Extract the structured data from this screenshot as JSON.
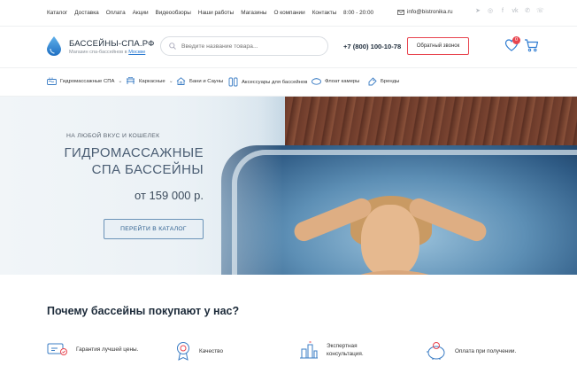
{
  "topbar": {
    "nav": [
      "Каталог",
      "Доставка",
      "Оплата",
      "Акции",
      "Видеообзоры",
      "Наши работы",
      "Магазины",
      "О компании",
      "Контакты"
    ],
    "hours": "8:00 - 20:00",
    "email": "info@bistronika.ru",
    "socials": [
      "telegram-icon",
      "instagram-icon",
      "facebook-icon",
      "vk-icon",
      "whatsapp-icon",
      "viber-icon"
    ]
  },
  "header": {
    "brand": "БАССЕЙНЫ-СПА.РФ",
    "tagline_prefix": "Магазин спа-бассейнов в ",
    "tagline_city": "Москве",
    "search_placeholder": "Введите название товара...",
    "phone": "+7 (800) 100-10-78",
    "callback_label": "Обратный звонок",
    "favorites_count": "0"
  },
  "categories": [
    {
      "label": "Гидромассажные СПА",
      "icon": "spa-icon",
      "dropdown": true
    },
    {
      "label": "Каркасные",
      "icon": "frame-pool-icon",
      "dropdown": true
    },
    {
      "label": "Бани и Сауны",
      "icon": "sauna-icon",
      "dropdown": false
    },
    {
      "label": "Аксессуары для бассейнов",
      "icon": "accessories-icon",
      "dropdown": false
    },
    {
      "label": "Флоат камеры",
      "icon": "float-icon",
      "dropdown": false
    },
    {
      "label": "Бренды",
      "icon": "brand-tag-icon",
      "dropdown": false
    }
  ],
  "hero": {
    "kicker": "НА ЛЮБОЙ ВКУС И КОШЕЛЕК",
    "title_line1": "ГИДРОМАССАЖНЫЕ",
    "title_line2": "СПА БАССЕЙНЫ",
    "price": "от 159 000 р.",
    "cta_label": "ПЕРЕЙТИ В КАТАЛОГ"
  },
  "why": {
    "title": "Почему бассейны покупают у нас?",
    "features": [
      {
        "label": "Гарантия лучшей цены.",
        "icon": "price-tag-icon"
      },
      {
        "label": "Качество",
        "icon": "quality-medal-icon"
      },
      {
        "label": "Экспертная консультация.",
        "icon": "consultation-icon"
      },
      {
        "label": "Оплата при получении.",
        "icon": "piggy-bank-icon"
      }
    ]
  },
  "colors": {
    "accent_blue": "#2d7bd1",
    "accent_red": "#e8454f",
    "icon_blue": "#3a7cc4"
  }
}
